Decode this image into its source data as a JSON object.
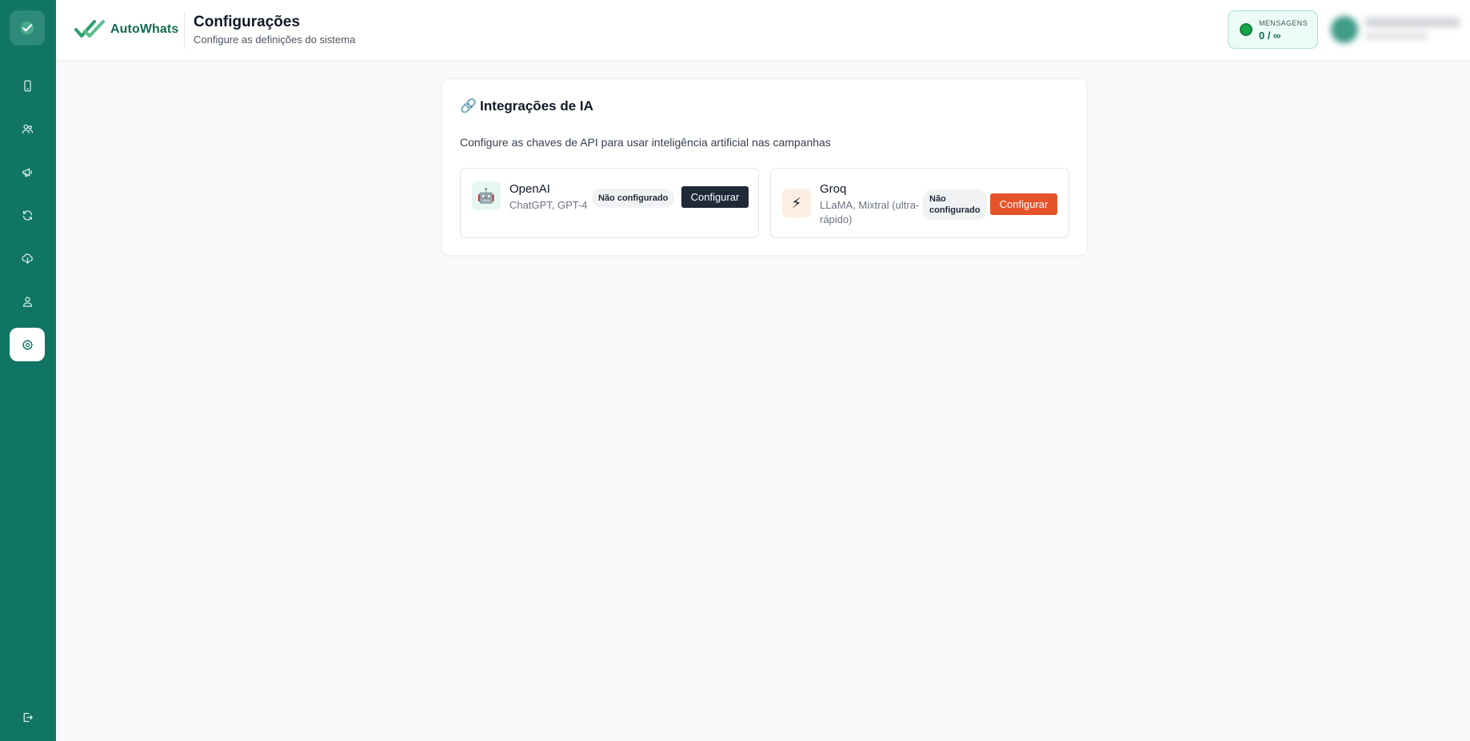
{
  "app": {
    "brand": "AutoWhats",
    "accent_color": "#117564"
  },
  "sidebar": {
    "logo_icon": "check-badge-icon",
    "items": [
      {
        "name": "devices",
        "icon": "phone-icon",
        "active": false
      },
      {
        "name": "contacts",
        "icon": "users-icon",
        "active": false
      },
      {
        "name": "campaigns",
        "icon": "megaphone-icon",
        "active": false
      },
      {
        "name": "automations",
        "icon": "refresh-icon",
        "active": false
      },
      {
        "name": "backup",
        "icon": "cloud-download-icon",
        "active": false
      },
      {
        "name": "profile",
        "icon": "user-icon",
        "active": false
      },
      {
        "name": "settings",
        "icon": "gear-icon",
        "active": true
      }
    ],
    "logout_icon": "logout-icon"
  },
  "header": {
    "title": "Configurações",
    "subtitle": "Configure as definições do sistema",
    "messages": {
      "label": "MENSAGENS",
      "value": "0 / ∞"
    }
  },
  "integrations": {
    "title_icon": "🔗",
    "title": "Integrações de IA",
    "description": "Configure as chaves de API para usar inteligência artificial nas campanhas",
    "providers": [
      {
        "name": "OpenAI",
        "icon": "🤖",
        "models": "ChatGPT, GPT-4",
        "status": "Não configurado",
        "button": "Configurar",
        "button_color": "#1f2937",
        "icon_bg": "#e7f7ef"
      },
      {
        "name": "Groq",
        "icon": "⚡",
        "models_line1": "LLaMA, Mixtral (ultra-",
        "models_line2": "rápido)",
        "status_line1": "Não",
        "status_line2": "configurado",
        "button": "Configurar",
        "button_color": "#e5532a",
        "icon_bg": "#fdeee2"
      }
    ]
  }
}
